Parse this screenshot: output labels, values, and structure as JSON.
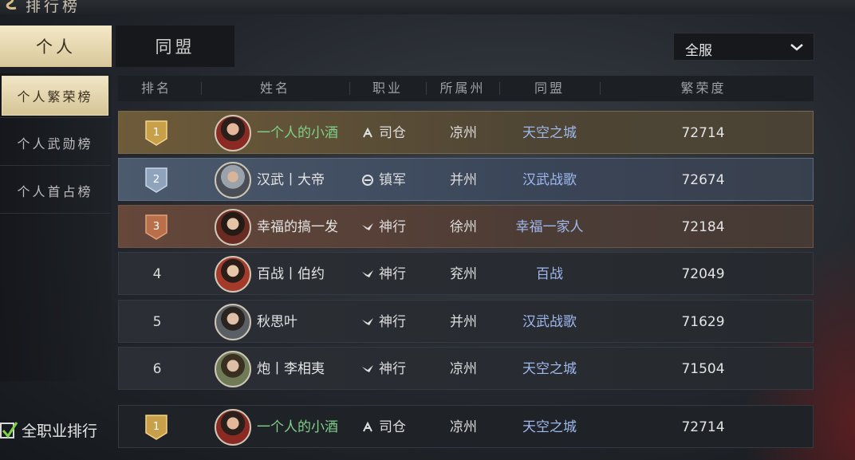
{
  "header": {
    "title": "排行榜"
  },
  "tabs": [
    {
      "label": "个人"
    },
    {
      "label": "同盟"
    }
  ],
  "server_filter": {
    "value": "全服"
  },
  "sidebar": {
    "items": [
      {
        "label": "个人繁荣榜"
      },
      {
        "label": "个人武勋榜"
      },
      {
        "label": "个人首占榜"
      }
    ]
  },
  "table": {
    "columns": [
      "排名",
      "姓名",
      "职业",
      "所属州",
      "同盟",
      "繁荣度"
    ],
    "rows": [
      {
        "rank": "1",
        "name": "一个人的小酒",
        "job": "司仓",
        "job_icon": "job-sicang-icon",
        "state": "凉州",
        "alliance": "天空之城",
        "score": "72714"
      },
      {
        "rank": "2",
        "name": "汉武丨大帝",
        "job": "镇军",
        "job_icon": "job-zhenjun-icon",
        "state": "并州",
        "alliance": "汉武战歌",
        "score": "72674"
      },
      {
        "rank": "3",
        "name": "幸福的搞一发",
        "job": "神行",
        "job_icon": "job-shenxing-icon",
        "state": "徐州",
        "alliance": "幸福一家人",
        "score": "72184"
      },
      {
        "rank": "4",
        "name": "百战丨伯约",
        "job": "神行",
        "job_icon": "job-shenxing-icon",
        "state": "兖州",
        "alliance": "百战",
        "score": "72049"
      },
      {
        "rank": "5",
        "name": "秋思叶",
        "job": "神行",
        "job_icon": "job-shenxing-icon",
        "state": "并州",
        "alliance": "汉武战歌",
        "score": "71629"
      },
      {
        "rank": "6",
        "name": "炮丨李相夷",
        "job": "神行",
        "job_icon": "job-shenxing-icon",
        "state": "凉州",
        "alliance": "天空之城",
        "score": "71504"
      }
    ]
  },
  "self_row": {
    "rank": "1",
    "name": "一个人的小酒",
    "job": "司仓",
    "state": "凉州",
    "alliance": "天空之城",
    "score": "72714"
  },
  "all_jobs_checkbox": {
    "label": "全职业排行",
    "checked": true
  },
  "colors": {
    "gold_badge": "#c9a04a",
    "silver_badge": "#8fa3bd",
    "bronze_badge": "#b86f4a",
    "highlight_name": "#7fd28a",
    "alliance_text": "#9fb8ee"
  }
}
